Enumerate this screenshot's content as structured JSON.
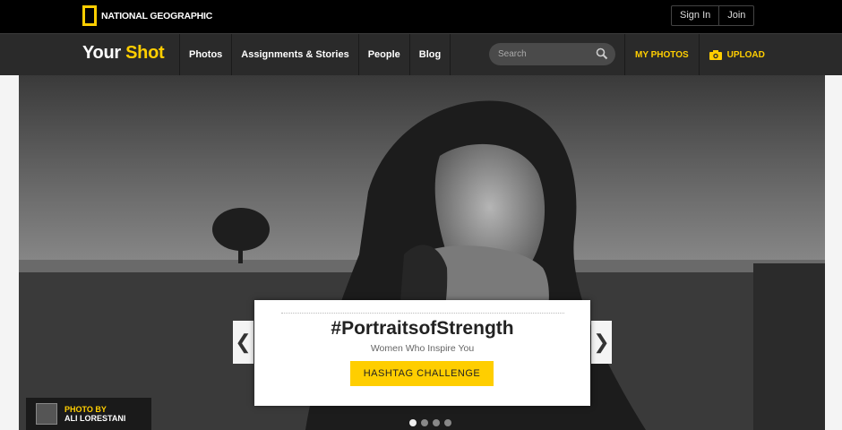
{
  "topbar": {
    "logo_text": "NATIONAL GEOGRAPHIC",
    "sign_in": "Sign In",
    "join": "Join"
  },
  "nav": {
    "brand_your": "Your",
    "brand_shot": "Shot",
    "items": [
      "Photos",
      "Assignments & Stories",
      "People",
      "Blog"
    ],
    "search_placeholder": "Search",
    "my_photos": "MY PHOTOS",
    "upload": "UPLOAD"
  },
  "hero": {
    "credit_label": "PHOTO BY",
    "credit_name": "ALI LORESTANI",
    "card_title": "#PortraitsofStrength",
    "card_subtitle": "Women Who Inspire You",
    "card_button": "HASHTAG CHALLENGE",
    "prev_arrow": "❮",
    "next_arrow": "❯",
    "slides_total": 4,
    "slide_active": 1
  },
  "colors": {
    "accent": "#ffce00",
    "nav_bg": "#2a2a2a",
    "top_bg": "#000000"
  }
}
